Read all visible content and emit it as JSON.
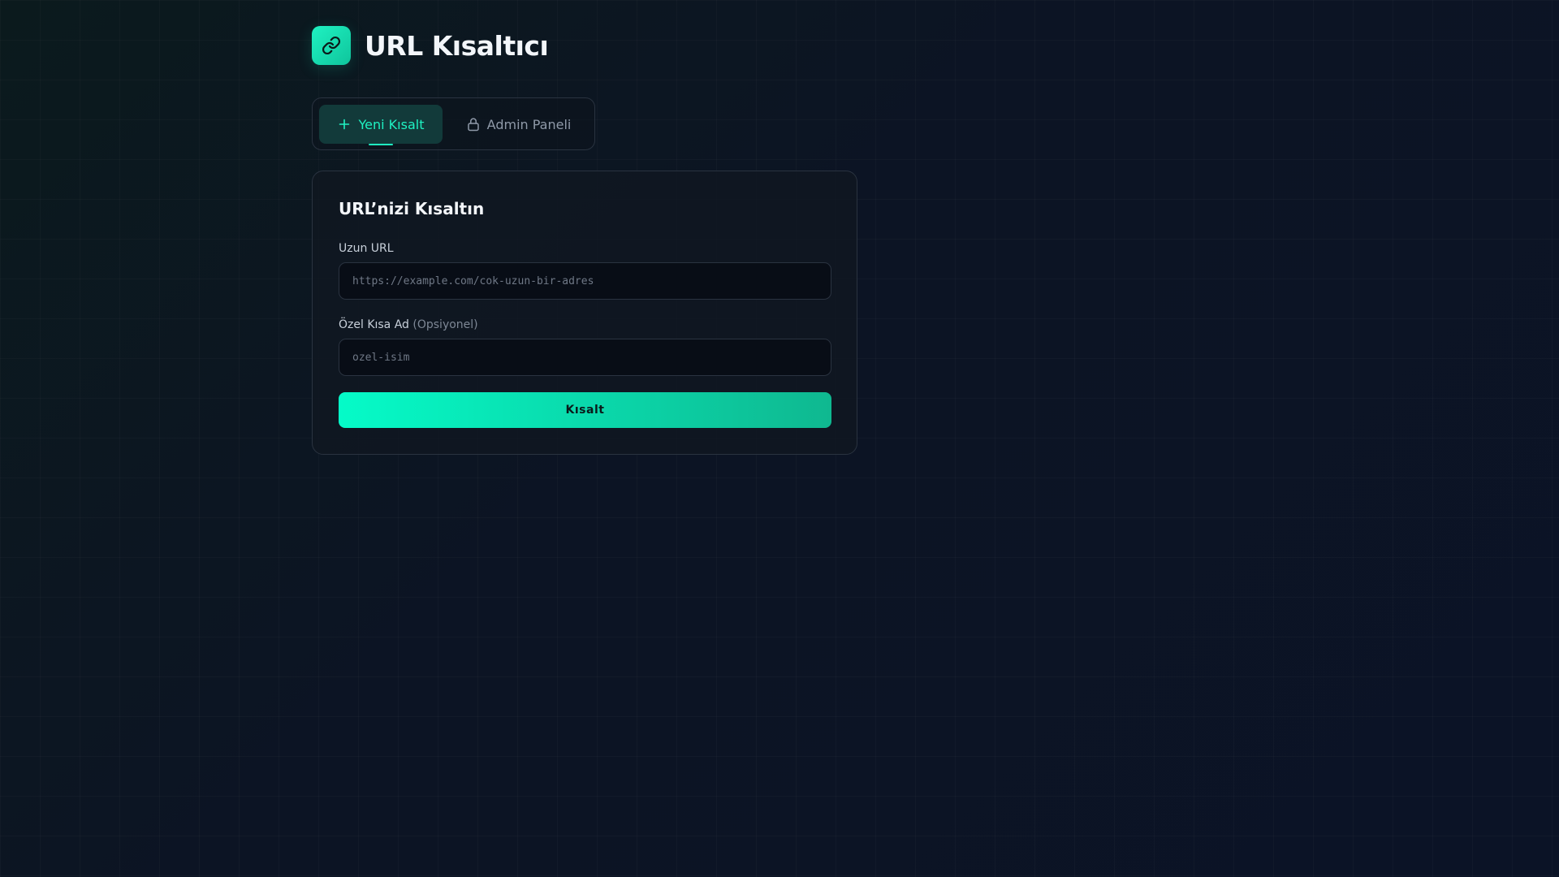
{
  "app": {
    "title": "URL Kısaltıcı",
    "logo_icon": "link-icon",
    "accent_color": "#1ff2c2"
  },
  "tabs": [
    {
      "label": "Yeni Kısalt",
      "icon": "plus-icon",
      "active": true
    },
    {
      "label": "Admin Paneli",
      "icon": "lock-icon",
      "active": false
    }
  ],
  "form": {
    "title": "URL’nizi Kısaltın",
    "long_url": {
      "label": "Uzun URL",
      "placeholder": "https://example.com/cok-uzun-bir-adres",
      "value": ""
    },
    "alias": {
      "label": "Özel Kısa Ad",
      "optional": "(Opsiyonel)",
      "placeholder": "ozel-isim",
      "value": ""
    },
    "submit_label": "Kısalt"
  }
}
